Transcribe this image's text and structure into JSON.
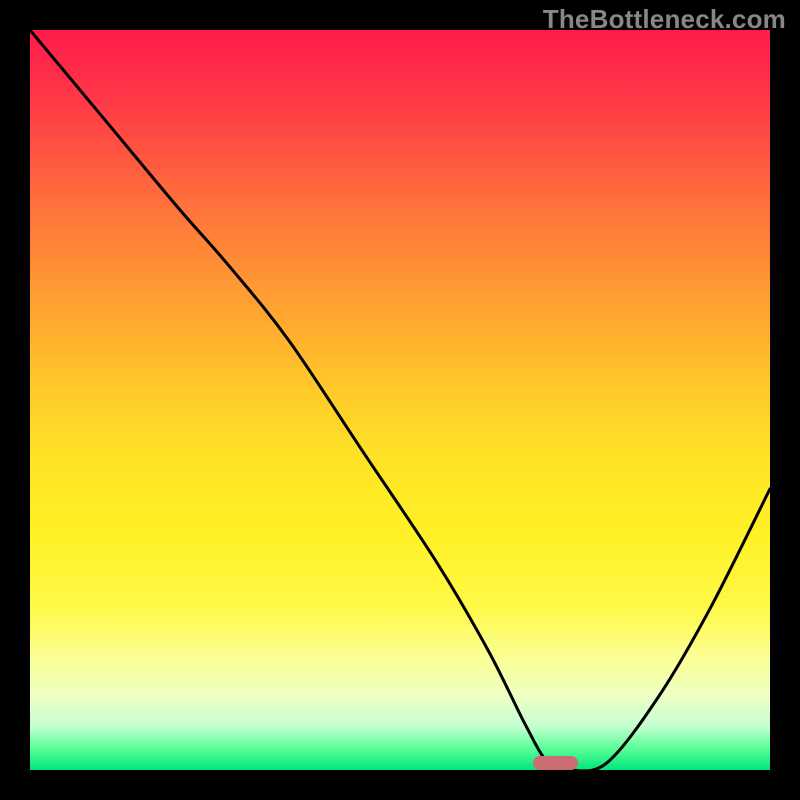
{
  "watermark": "TheBottleneck.com",
  "chart_data": {
    "type": "line",
    "title": "",
    "xlabel": "",
    "ylabel": "",
    "xlim": [
      0,
      100
    ],
    "ylim": [
      0,
      100
    ],
    "x": [
      0,
      10,
      20,
      27,
      35,
      45,
      55,
      62,
      67,
      70,
      73,
      78,
      85,
      92,
      100
    ],
    "values": [
      100,
      88,
      76,
      68,
      58,
      43,
      28,
      16,
      6,
      1,
      0,
      1,
      10,
      22,
      38
    ],
    "marker": {
      "x_center": 71,
      "width_pct": 6,
      "y": 0.4
    },
    "colors": {
      "top": "#ff1a4b",
      "mid_orange": "#ff9a33",
      "mid_yellow": "#fff126",
      "bottom": "#00e67a",
      "curve": "#000000",
      "marker": "#cc6d72"
    }
  }
}
